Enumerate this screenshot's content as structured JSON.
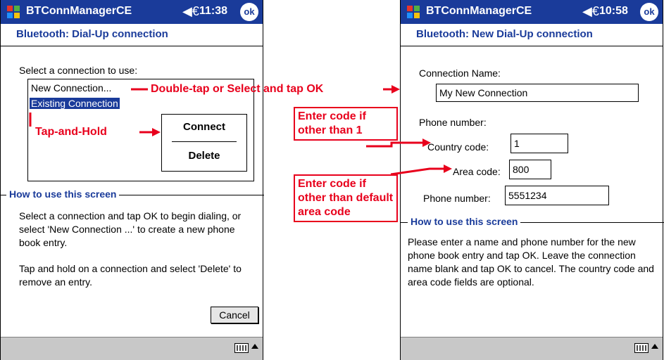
{
  "left": {
    "titlebar": {
      "app": "BTConnManagerCE",
      "time": "11:38",
      "ok": "ok"
    },
    "heading": "Bluetooth: Dial-Up connection",
    "select_label": "Select a connection to use:",
    "list": [
      "New Connection...",
      "Existing Connection"
    ],
    "context_menu": [
      "Connect",
      "Delete"
    ],
    "section_title": "How to use this screen",
    "help1": "Select a connection and tap OK to begin dialing, or select 'New Connection ...' to create a new phone book entry.",
    "help2": "Tap and hold on a connection and select 'Delete' to remove an entry.",
    "cancel": "Cancel"
  },
  "right": {
    "titlebar": {
      "app": "BTConnManagerCE",
      "time": "10:58",
      "ok": "ok"
    },
    "heading": "Bluetooth: New Dial-Up connection",
    "conn_name_label": "Connection Name:",
    "conn_name_value": "My New Connection",
    "phone_label": "Phone number:",
    "country_label": "Country code:",
    "country_value": "1",
    "area_label": "Area code:",
    "area_value": "800",
    "phone_num_label": "Phone number:",
    "phone_num_value": "5551234",
    "section_title": "How to use this screen",
    "help": "Please enter a name and phone number for the new phone book entry and tap OK. Leave the connection name blank and tap OK to cancel. The country code and area code fields are optional."
  },
  "annotations": {
    "double_tap": "Double-tap or Select and tap OK",
    "tap_hold": "Tap-and-Hold",
    "country_note": "Enter code if other than 1",
    "area_note": "Enter code if other than default area code"
  },
  "colors": {
    "title_blue": "#1a3b9a",
    "annotation_red": "#e8001c"
  }
}
